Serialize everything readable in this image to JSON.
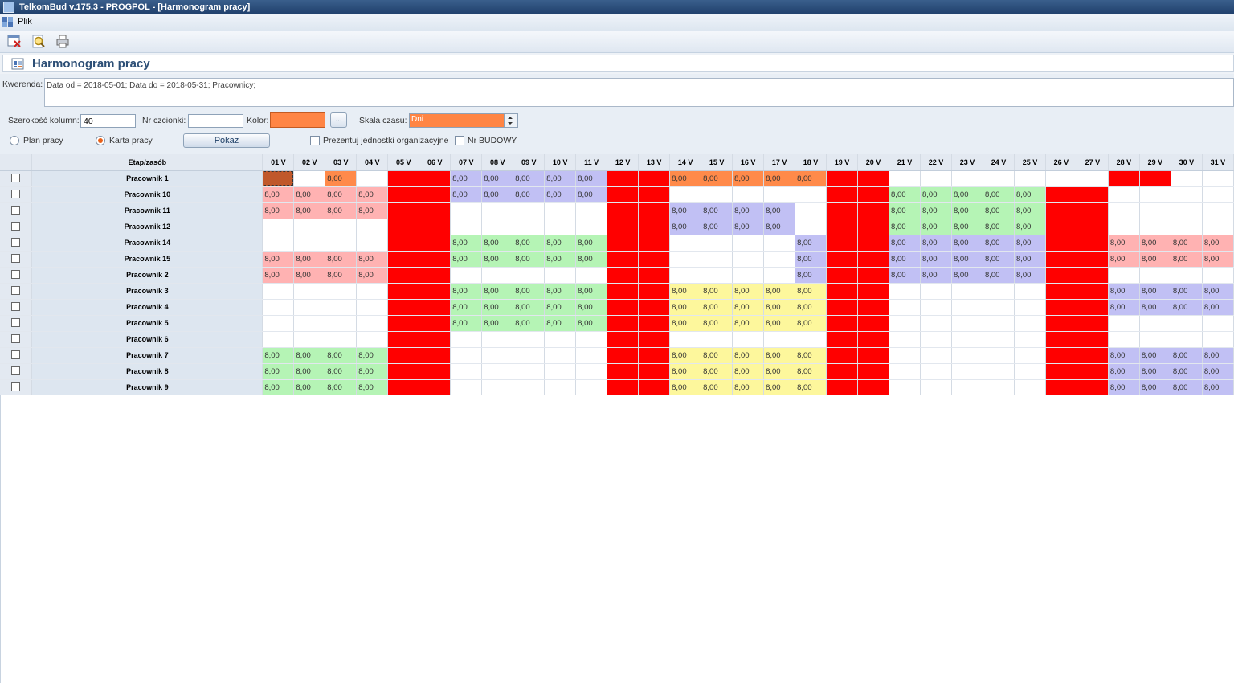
{
  "window": {
    "title": "TelkomBud v.175.3 - PROGPOL - [Harmonogram pracy]"
  },
  "menu": {
    "items": [
      "Plik"
    ]
  },
  "toolbar": {
    "buttons": [
      "close-icon",
      "preview-icon",
      "print-icon"
    ]
  },
  "page": {
    "title": "Harmonogram pracy"
  },
  "filters": {
    "query_label": "Kwerenda:",
    "query_value": "Data od = 2018-05-01; Data do = 2018-05-31; Pracownicy;",
    "col_width_label": "Szerokość kolumn:",
    "col_width_value": "40",
    "font_label": "Nr czcionki:",
    "font_value": "",
    "color_label": "Kolor:",
    "color_value": "#ff8544",
    "browse_label": "...",
    "scale_label": "Skala czasu:",
    "scale_value": "Dni",
    "radio_plan": "Plan pracy",
    "radio_card": "Karta pracy",
    "show_button": "Pokaż",
    "check_org": "Prezentuj jednostki organizacyjne",
    "check_budowy": "Nr BUDOWY"
  },
  "grid": {
    "header_resource": "Etap/zasób",
    "days": [
      "01 V",
      "02 V",
      "03 V",
      "04 V",
      "05 V",
      "06 V",
      "07 V",
      "08 V",
      "09 V",
      "10 V",
      "11 V",
      "12 V",
      "13 V",
      "14 V",
      "15 V",
      "16 V",
      "17 V",
      "18 V",
      "19 V",
      "20 V",
      "21 V",
      "22 V",
      "23 V",
      "24 V",
      "25 V",
      "26 V",
      "27 V",
      "28 V",
      "29 V",
      "30 V",
      "31 V"
    ],
    "colors": {
      "R": "#ff0000",
      "O": "#ff8a4a",
      "P": "#ffb2b2",
      "B": "#c1c0f4",
      "G": "#b5f4b5",
      "Y": "#fdf79c",
      "S": "#c0582b"
    },
    "rows": [
      {
        "name": "Pracownik 1",
        "cells": "S_O_RRBBBBBRROOOOORR_______RR____"
      },
      {
        "name": "Pracownik 10",
        "cells": "PPPPRRBBBBBRR_____RRGGGGGRR____"
      },
      {
        "name": "Pracownik 11",
        "cells": "PPPPRR_____RRBBBB_RRGGGGGRR____"
      },
      {
        "name": "Pracownik 12",
        "cells": "____RR_____RRBBBB_RRGGGGGRR____"
      },
      {
        "name": "Pracownik 14",
        "cells": "____RRGGGGGRR____BRRBBBBBRRPPPP"
      },
      {
        "name": "Pracownik 15",
        "cells": "PPPPRRGGGGGRR____BRRBBBBBRRPPPP"
      },
      {
        "name": "Pracownik 2",
        "cells": "PPPPRR_____RR____BRRBBBBBRR____"
      },
      {
        "name": "Pracownik 3",
        "cells": "____RRGGGGGRRYYYYYRR_____RRBBBB"
      },
      {
        "name": "Pracownik 4",
        "cells": "____RRGGGGGRRYYYYYRR_____RRBBBB"
      },
      {
        "name": "Pracownik 5",
        "cells": "____RRGGGGGRRYYYYYRR_____RR____"
      },
      {
        "name": "Pracownik 6",
        "cells": "____RR_____RR_____RR_____RR____"
      },
      {
        "name": "Pracownik 7",
        "cells": "GGGGRR_____RRYYYYYRR_____RRBBBB"
      },
      {
        "name": "Pracownik 8",
        "cells": "GGGGRR_____RRYYYYYRR_____RRBBBB"
      },
      {
        "name": "Pracownik 9",
        "cells": "GGGGRR_____RRYYYYYRR_____RRBBBB"
      }
    ],
    "cell_value": "8,00"
  }
}
